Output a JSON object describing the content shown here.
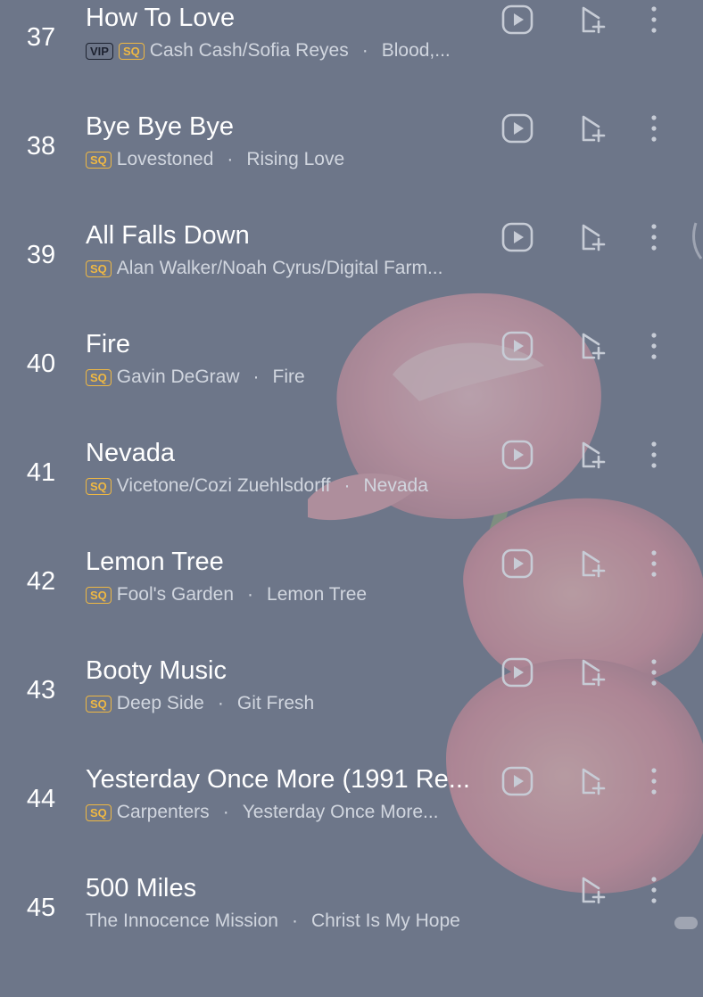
{
  "songs": [
    {
      "index": "37",
      "title": "How To Love",
      "badges": [
        "VIP",
        "SQ"
      ],
      "artist": "Cash Cash/Sofia Reyes",
      "album": "Blood,...",
      "has_play": true
    },
    {
      "index": "38",
      "title": "Bye Bye Bye",
      "badges": [
        "SQ"
      ],
      "artist": "Lovestoned",
      "album": "Rising Love",
      "has_play": true
    },
    {
      "index": "39",
      "title": "All Falls Down",
      "badges": [
        "SQ"
      ],
      "artist": "Alan Walker/Noah Cyrus/Digital Farm...",
      "album": "",
      "has_play": true
    },
    {
      "index": "40",
      "title": "Fire",
      "badges": [
        "SQ"
      ],
      "artist": "Gavin DeGraw",
      "album": "Fire",
      "has_play": true
    },
    {
      "index": "41",
      "title": "Nevada",
      "badges": [
        "SQ"
      ],
      "artist": "Vicetone/Cozi Zuehlsdorff",
      "album": "Nevada",
      "has_play": true
    },
    {
      "index": "42",
      "title": "Lemon Tree",
      "badges": [
        "SQ"
      ],
      "artist": "Fool's Garden",
      "album": "Lemon Tree",
      "has_play": true
    },
    {
      "index": "43",
      "title": "Booty Music",
      "badges": [
        "SQ"
      ],
      "artist": "Deep Side",
      "album": "Git Fresh",
      "has_play": true
    },
    {
      "index": "44",
      "title": "Yesterday Once More (1991 Re...",
      "badges": [
        "SQ"
      ],
      "artist": "Carpenters",
      "album": "Yesterday Once More...",
      "has_play": true
    },
    {
      "index": "45",
      "title": "500 Miles",
      "badges": [],
      "artist": "The Innocence Mission",
      "album": "Christ Is My Hope",
      "has_play": false
    }
  ],
  "separator": "·",
  "icons": {
    "play": "play-video-icon",
    "add": "add-to-playlist-icon",
    "more": "more-options-icon"
  },
  "colors": {
    "background": "#6d7689",
    "title": "#ffffff",
    "subtitle": "#d1d6df",
    "sq_badge": "#efb843",
    "vip_badge": "#1d2230",
    "icon": "#c7ccd6",
    "rose": "#e9a7b0"
  }
}
